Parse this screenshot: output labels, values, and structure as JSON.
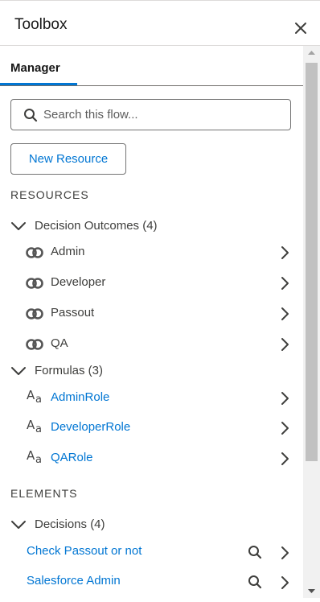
{
  "panel": {
    "title": "Toolbox"
  },
  "tabs": [
    {
      "label": "Manager",
      "active": true
    }
  ],
  "search": {
    "placeholder": "Search this flow...",
    "value": ""
  },
  "new_resource_label": "New Resource",
  "resources": {
    "heading": "RESOURCES",
    "groups": [
      {
        "label": "Decision Outcomes (4)",
        "icon": "outcome-icon",
        "items": [
          {
            "label": "Admin"
          },
          {
            "label": "Developer"
          },
          {
            "label": "Passout"
          },
          {
            "label": "QA"
          }
        ]
      },
      {
        "label": "Formulas (3)",
        "icon": "text-formula-icon",
        "items": [
          {
            "label": "AdminRole"
          },
          {
            "label": "DeveloperRole"
          },
          {
            "label": "QARole"
          }
        ]
      }
    ]
  },
  "elements": {
    "heading": "ELEMENTS",
    "groups": [
      {
        "label": "Decisions (4)",
        "items": [
          {
            "label": "Check Passout or not"
          },
          {
            "label": "Salesforce Admin"
          }
        ]
      }
    ]
  },
  "colors": {
    "link": "#0176d3",
    "text": "#3e3e3c",
    "tab_active": "#0176d3",
    "scroll_thumb": "#c1c1c1"
  }
}
